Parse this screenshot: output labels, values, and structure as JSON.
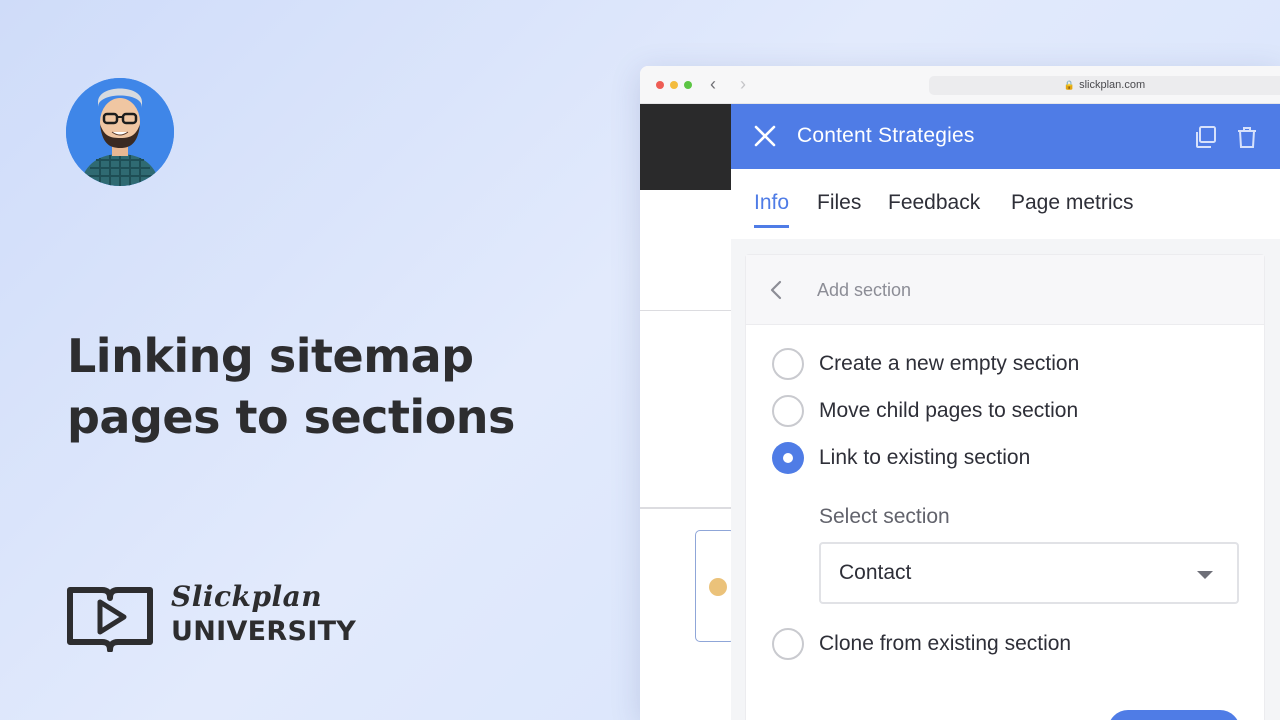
{
  "lesson": {
    "title_line1": "Linking sitemap",
    "title_line2": "pages to sections"
  },
  "logo": {
    "brand": "Slickplan",
    "sub": "UNIVERSITY"
  },
  "browser": {
    "url": "slickplan.com",
    "icons": [
      "back-arrow-icon",
      "forward-arrow-icon",
      "lock-icon"
    ]
  },
  "panel": {
    "title": "Content Strategies",
    "header_icons": [
      "close-icon",
      "duplicate-icon",
      "trash-icon"
    ],
    "tabs": [
      {
        "label": "Info",
        "active": true
      },
      {
        "label": "Files",
        "active": false
      },
      {
        "label": "Feedback",
        "active": false
      },
      {
        "label": "Page metrics",
        "active": false
      }
    ]
  },
  "add_section": {
    "title": "Add section",
    "options": [
      {
        "label": "Create a new empty section",
        "checked": false
      },
      {
        "label": "Move child pages to section",
        "checked": false
      },
      {
        "label": "Link to existing section",
        "checked": true
      },
      {
        "label": "Clone from existing section",
        "checked": false
      }
    ],
    "select_label": "Select section",
    "select_value": "Contact"
  },
  "colors": {
    "accent": "#4f7ce6",
    "text": "#2e2f38",
    "background": "#dbe5fb"
  }
}
